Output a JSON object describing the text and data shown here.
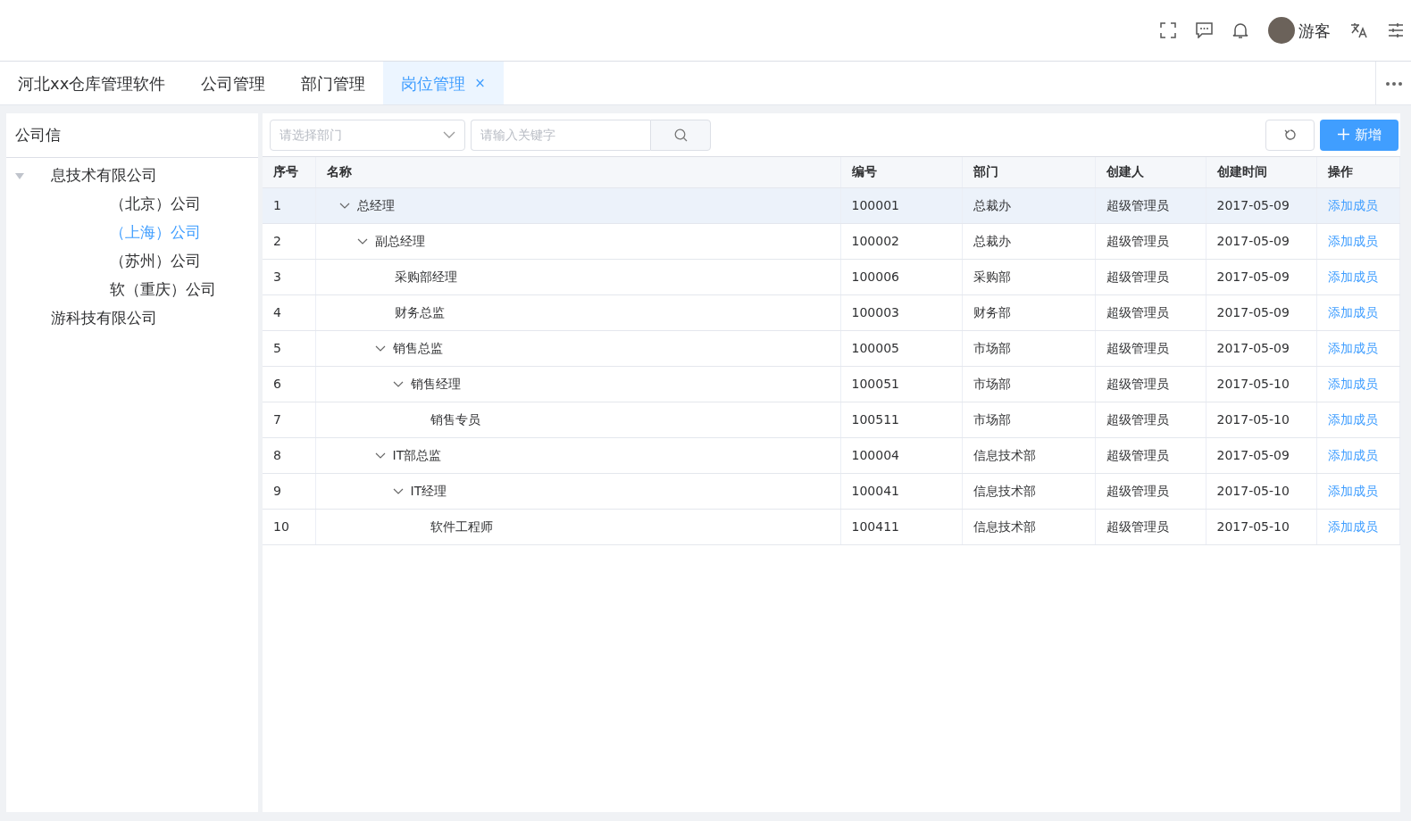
{
  "header": {
    "user": "游客"
  },
  "tabs": [
    {
      "label": "河北xx仓库管理软件",
      "selected": false
    },
    {
      "label": "公司管理",
      "selected": false
    },
    {
      "label": "部门管理",
      "selected": false
    },
    {
      "label": "岗位管理",
      "selected": true,
      "close": "×"
    }
  ],
  "sidebar": {
    "title": "公司信",
    "tree": [
      {
        "label": "息技术有限公司",
        "expanded": true,
        "selected": false,
        "children": [
          {
            "label": "（北京）公司",
            "selected": false
          },
          {
            "label": "（上海）公司",
            "selected": true
          },
          {
            "label": "（苏州）公司",
            "selected": false
          },
          {
            "label": "软（重庆）公司",
            "selected": false
          }
        ]
      },
      {
        "label": "游科技有限公司",
        "selected": false
      }
    ]
  },
  "toolbar": {
    "department_placeholder": "请选择部门",
    "search_placeholder": "请输入关键字",
    "add_button": "新增"
  },
  "table": {
    "columns": [
      "序号",
      "名称",
      "编号",
      "部门",
      "创建人",
      "创建时间",
      "操作"
    ],
    "rows": [
      {
        "index": "1",
        "name": "总经理",
        "code": "100001",
        "dept": "总裁办",
        "creator": "超级管理员",
        "date": "2017-05-09",
        "action": "添加成员",
        "selected": true,
        "expanded": true,
        "children": [
          {
            "index": "2",
            "name": "副总经理",
            "code": "100002",
            "dept": "总裁办",
            "creator": "超级管理员",
            "date": "2017-05-09",
            "action": "添加成员",
            "selected": false,
            "expanded": true,
            "children": [
              {
                "index": "3",
                "name": "采购部经理",
                "code": "100006",
                "dept": "采购部",
                "creator": "超级管理员",
                "date": "2017-05-09",
                "action": "添加成员",
                "selected": false
              },
              {
                "index": "4",
                "name": "财务总监",
                "code": "100003",
                "dept": "财务部",
                "creator": "超级管理员",
                "date": "2017-05-09",
                "action": "添加成员",
                "selected": false
              },
              {
                "index": "5",
                "name": "销售总监",
                "code": "100005",
                "dept": "市场部",
                "creator": "超级管理员",
                "date": "2017-05-09",
                "action": "添加成员",
                "selected": false,
                "expanded": true,
                "children": [
                  {
                    "index": "6",
                    "name": "销售经理",
                    "code": "100051",
                    "dept": "市场部",
                    "creator": "超级管理员",
                    "date": "2017-05-10",
                    "action": "添加成员",
                    "selected": false,
                    "expanded": true,
                    "children": [
                      {
                        "index": "7",
                        "name": "销售专员",
                        "code": "100511",
                        "dept": "市场部",
                        "creator": "超级管理员",
                        "date": "2017-05-10",
                        "action": "添加成员",
                        "selected": false
                      }
                    ]
                  }
                ]
              },
              {
                "index": "8",
                "name": "IT部总监",
                "code": "100004",
                "dept": "信息技术部",
                "creator": "超级管理员",
                "date": "2017-05-09",
                "action": "添加成员",
                "selected": false,
                "expanded": true,
                "children": [
                  {
                    "index": "9",
                    "name": "IT经理",
                    "code": "100041",
                    "dept": "信息技术部",
                    "creator": "超级管理员",
                    "date": "2017-05-10",
                    "action": "添加成员",
                    "selected": false,
                    "expanded": true,
                    "children": [
                      {
                        "index": "10",
                        "name": "软件工程师",
                        "code": "100411",
                        "dept": "信息技术部",
                        "creator": "超级管理员",
                        "date": "2017-05-10",
                        "action": "添加成员",
                        "selected": false
                      }
                    ]
                  }
                ]
              }
            ]
          }
        ]
      }
    ]
  }
}
